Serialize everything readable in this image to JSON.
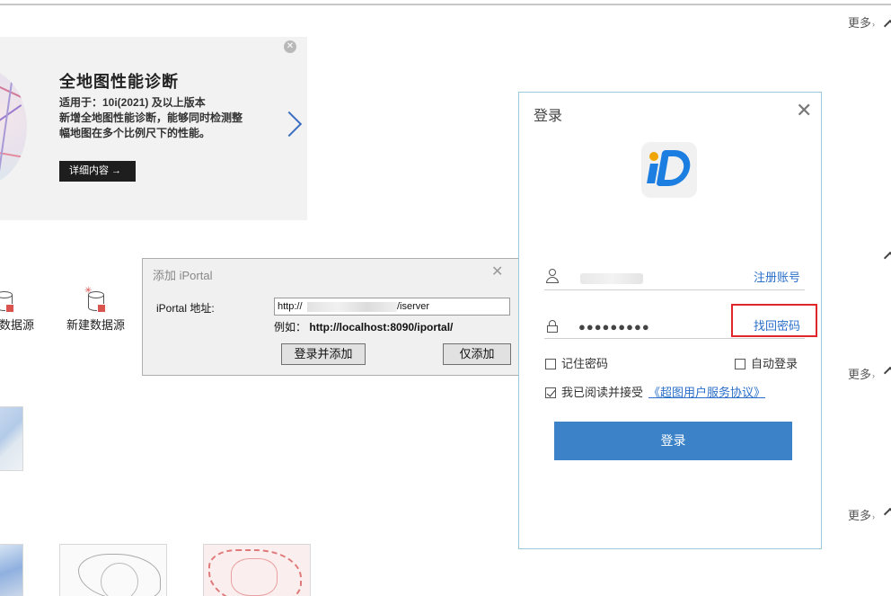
{
  "page": {
    "more_label": "更多",
    "more_chevron": "›"
  },
  "banner": {
    "close_glyph": "✕",
    "title": "全地图性能诊断",
    "line1": "适用于：10i(2021) 及以上版本",
    "line2": "新增全地图性能诊断，能够同时检测整",
    "line3": "幅地图在多个比例尺下的性能。",
    "button_label": "详细内容 →"
  },
  "datasources": {
    "open_partial_label": "数据源",
    "new_label": "新建数据源"
  },
  "iportal_dialog": {
    "title": "添加 iPortal",
    "close_glyph": "✕",
    "address_label": "iPortal 地址:",
    "address_prefix": "http://",
    "address_suffix": "/iserver",
    "example_label": "例如：",
    "example_value": "http://localhost:8090/iportal/",
    "login_add_button": "登录并添加",
    "add_only_button": "仅添加"
  },
  "login_dialog": {
    "title": "登录",
    "close_glyph": "✕",
    "register_link": "注册账号",
    "password_mask": "●●●●●●●●●",
    "forgot_link": "找回密码",
    "remember_password": "记住密码",
    "auto_login": "自动登录",
    "agree_text": "我已阅读并接受",
    "agreement_link": "《超图用户服务协议》",
    "login_button": "登录",
    "remember_checked": false,
    "auto_checked": false,
    "agree_checked": true
  },
  "colors": {
    "accent": "#3b82c8",
    "link": "#2a6fc9",
    "highlight": "#e0262a"
  }
}
